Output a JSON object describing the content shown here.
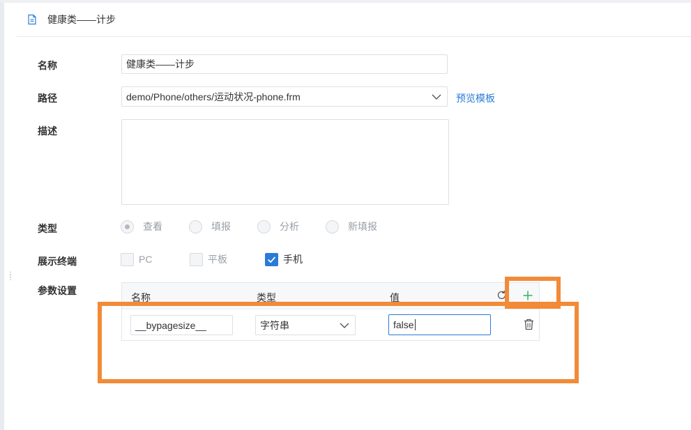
{
  "header": {
    "title": "健康类——计步",
    "icon": "document-icon"
  },
  "form": {
    "name": {
      "label": "名称",
      "value": "健康类——计步"
    },
    "path": {
      "label": "路径",
      "value": "demo/Phone/others/运动状况-phone.frm",
      "preview_link": "预览模板"
    },
    "description": {
      "label": "描述",
      "value": ""
    },
    "type": {
      "label": "类型",
      "options": [
        "查看",
        "填报",
        "分析",
        "新填报"
      ],
      "selected": "查看"
    },
    "terminal": {
      "label": "展示终端",
      "options": [
        {
          "label": "PC",
          "checked": false
        },
        {
          "label": "平板",
          "checked": false
        },
        {
          "label": "手机",
          "checked": true
        }
      ]
    },
    "params": {
      "label": "参数设置",
      "columns": [
        "名称",
        "类型",
        "值"
      ],
      "rows": [
        {
          "name": "__bypagesize__",
          "type": "字符串",
          "value": "false"
        }
      ]
    }
  },
  "colors": {
    "accent": "#2a7bd8",
    "annotation": "#f28a37",
    "add": "#3cb46e"
  }
}
